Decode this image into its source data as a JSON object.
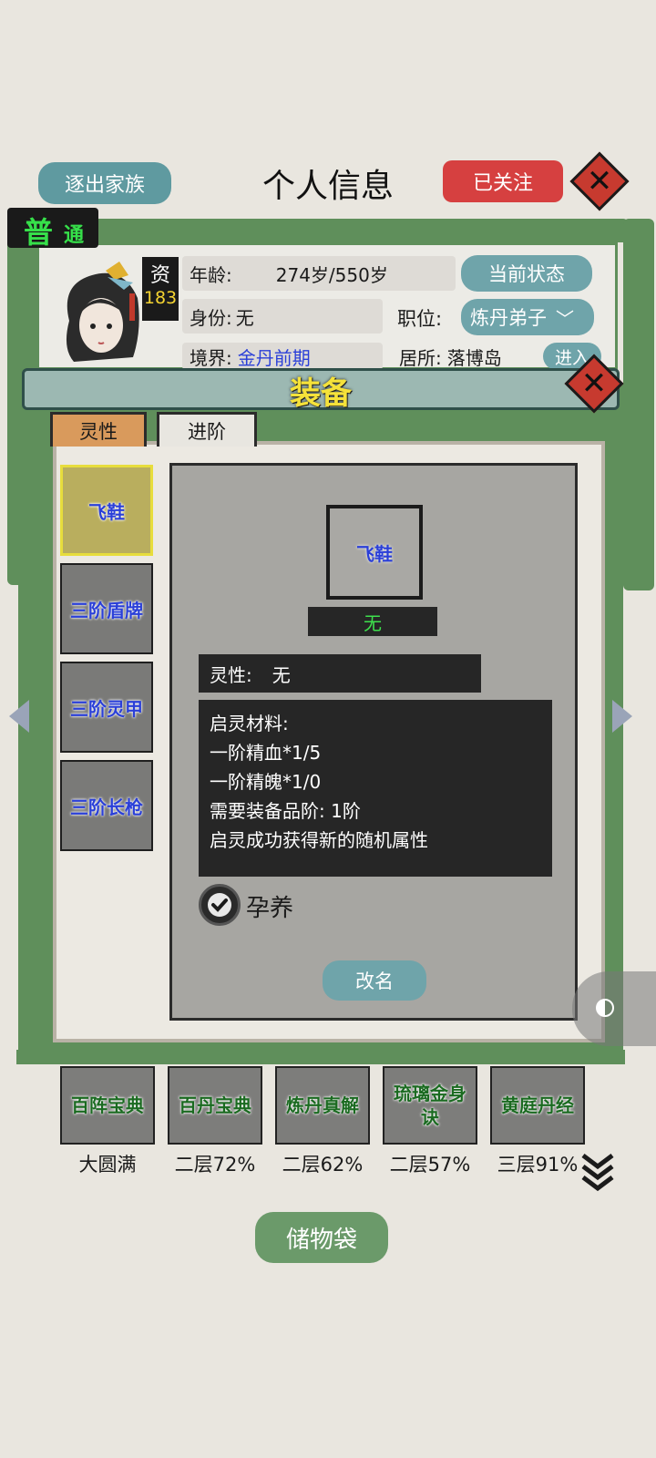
{
  "header": {
    "expel_button": "逐出家族",
    "title": "个人信息",
    "follow_button": "已关注"
  },
  "profile": {
    "rarity_badge": {
      "big": "普",
      "small": "通"
    },
    "aptitude_label": "资",
    "aptitude_value": "183",
    "age_label": "年龄:",
    "age_value": "274岁/550岁",
    "status_button": "当前状态",
    "identity_label": "身份:",
    "identity_value": "无",
    "position_label": "职位:",
    "position_value": "炼丹弟子",
    "realm_label": "境界:",
    "realm_value": "金丹前期",
    "residence_label": "居所:",
    "residence_value": "落博岛",
    "enter_button": "进入"
  },
  "equipment_panel": {
    "title": "装备",
    "tabs": [
      {
        "label": "灵性",
        "active": true
      },
      {
        "label": "进阶",
        "active": false
      }
    ],
    "slots": [
      {
        "label": "飞鞋",
        "selected": true
      },
      {
        "label": "三阶盾牌",
        "selected": false
      },
      {
        "label": "三阶灵甲",
        "selected": false
      },
      {
        "label": "三阶长枪",
        "selected": false
      }
    ],
    "detail": {
      "item_name": "飞鞋",
      "grade_value": "无",
      "spirit_label": "灵性:",
      "spirit_value": "无",
      "materials_title": "启灵材料:",
      "materials": [
        "一阶精血*1/5",
        "一阶精魄*1/0",
        "需要装备品阶: 1阶",
        "启灵成功获得新的随机属性"
      ],
      "nurture_label": "孕养",
      "nurture_checked": true,
      "rename_button": "改名"
    }
  },
  "books": [
    {
      "name": "百阵宝典",
      "level": "大圆满"
    },
    {
      "name": "百丹宝典",
      "level": "二层72%"
    },
    {
      "name": "炼丹真解",
      "level": "二层62%"
    },
    {
      "name": "琉璃金身诀",
      "level": "二层57%"
    },
    {
      "name": "黄庭丹经",
      "level": "三层91%"
    }
  ],
  "storage_button": "储物袋",
  "colors": {
    "frame_green": "#5f8f5b",
    "accent_teal": "#5f9aa0",
    "follow_red": "#d64040",
    "slot_text_blue": "#2a3fd8",
    "book_text_green": "#1a6a20",
    "rarity_green": "#36e04a",
    "aptitude_yellow": "#f5d431",
    "realm_blue": "#2a3fd8"
  }
}
